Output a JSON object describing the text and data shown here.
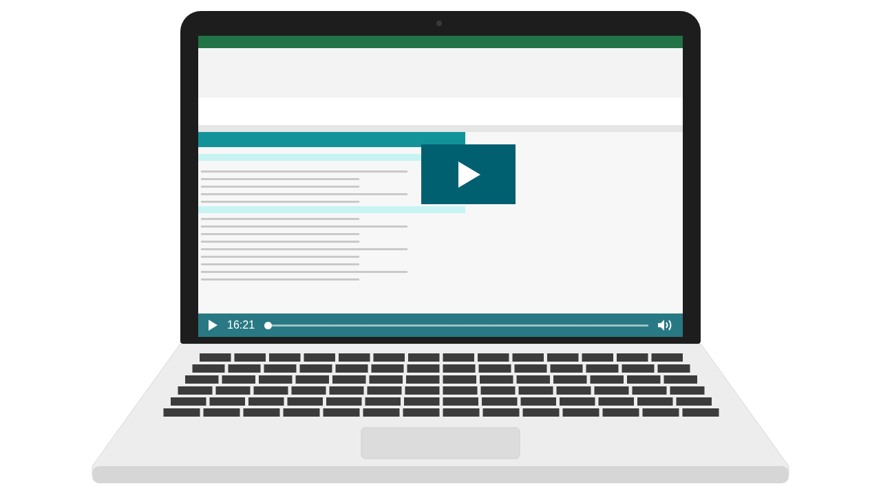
{
  "video_player": {
    "playing": false,
    "current_time": "16:21",
    "progress": {
      "level": 0.0
    }
  }
}
